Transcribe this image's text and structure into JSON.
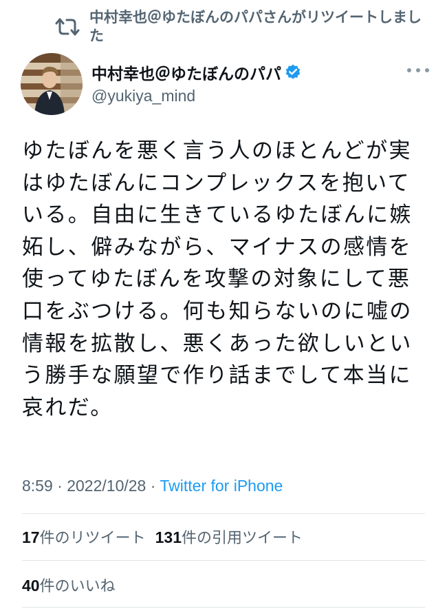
{
  "retweet": {
    "icon": "retweet-icon",
    "text": "中村幸也＠ゆたぼんのパパさんがリツイートしました"
  },
  "author": {
    "avatar_icon": "avatar-photo",
    "display_name": "中村幸也＠ゆたぼんのパパ",
    "verified_icon": "verified-badge-icon",
    "handle": "@yukiya_mind"
  },
  "more_icon": "more-options-icon",
  "tweet": {
    "lines": [
      "ゆたぼんを悪く言う人のほとんどが実",
      "はゆたぼんにコンプレックスを抱いて",
      "いる。自由に生きているゆたぼんに嫉",
      "妬し、僻みながら、マイナスの感情を",
      "使ってゆたぼんを攻撃の対象にして悪",
      "口をぶつける。何も知らないのに嘘の",
      "情報を拡散し、悪くあった欲しいとい",
      "う勝手な願望で作り話までして本当に",
      "哀れだ。"
    ]
  },
  "meta": {
    "time": "8:59",
    "separator": " · ",
    "date": "2022/10/28",
    "source": "Twitter for iPhone"
  },
  "stats": {
    "retweets_count": "17",
    "retweets_label": "件のリツイート",
    "quotes_count": "131",
    "quotes_label": "件の引用ツイート",
    "likes_count": "40",
    "likes_label": "件のいいね"
  },
  "colors": {
    "text_primary": "#0f1419",
    "text_secondary": "#536471",
    "link": "#1d9bf0",
    "verified": "#1d9bf0"
  }
}
